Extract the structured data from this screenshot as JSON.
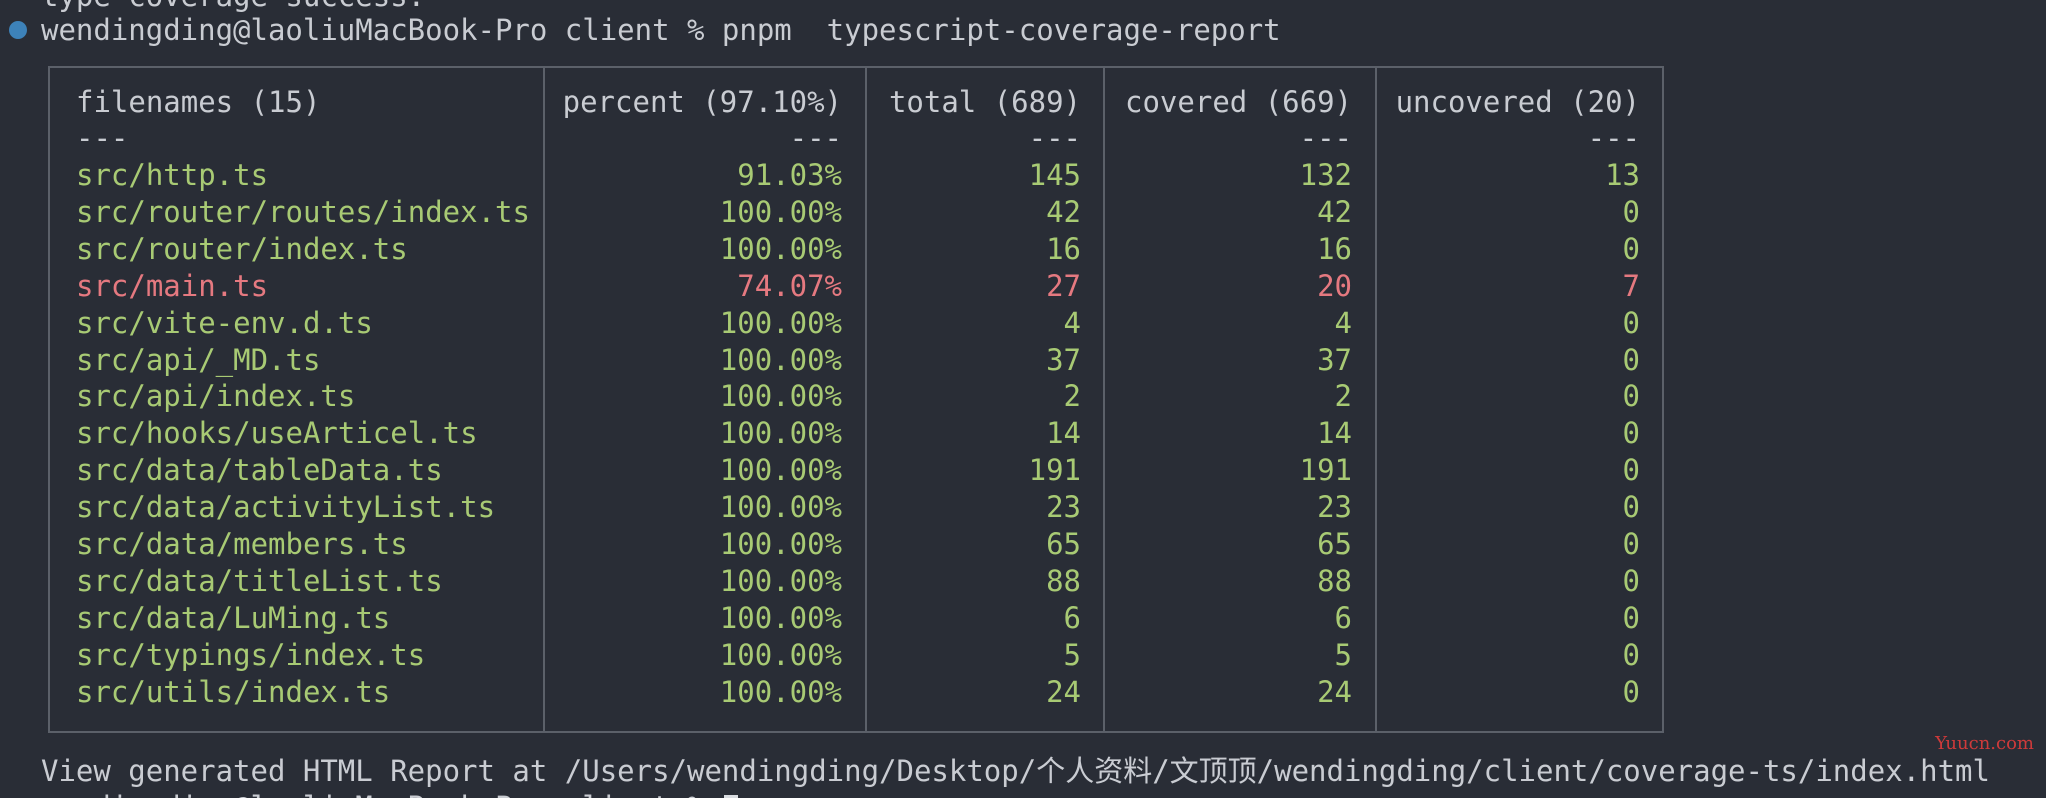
{
  "terminal": {
    "previous_line": "type-coverage success.",
    "prompt": "wendingding@laoliuMacBook-Pro client % pnpm  typescript-coverage-report",
    "report_line": "View generated HTML Report at /Users/wendingding/Desktop/个人资料/文顶顶/wendingding/client/coverage-ts/index.html",
    "next_prompt": "wendingding@laoliuMacBook-Pro client % "
  },
  "table": {
    "headers": {
      "filenames": "filenames (15)",
      "percent": "percent (97.10%)",
      "total": "total (689)",
      "covered": "covered (669)",
      "uncovered": "uncovered (20)"
    },
    "separator": "---",
    "rows": [
      {
        "file": "src/http.ts",
        "percent": "91.03%",
        "total": "145",
        "covered": "132",
        "uncovered": "13",
        "status": "ok"
      },
      {
        "file": "src/router/routes/index.ts",
        "percent": "100.00%",
        "total": "42",
        "covered": "42",
        "uncovered": "0",
        "status": "ok"
      },
      {
        "file": "src/router/index.ts",
        "percent": "100.00%",
        "total": "16",
        "covered": "16",
        "uncovered": "0",
        "status": "ok"
      },
      {
        "file": "src/main.ts",
        "percent": "74.07%",
        "total": "27",
        "covered": "20",
        "uncovered": "7",
        "status": "bad"
      },
      {
        "file": "src/vite-env.d.ts",
        "percent": "100.00%",
        "total": "4",
        "covered": "4",
        "uncovered": "0",
        "status": "ok"
      },
      {
        "file": "src/api/_MD.ts",
        "percent": "100.00%",
        "total": "37",
        "covered": "37",
        "uncovered": "0",
        "status": "ok"
      },
      {
        "file": "src/api/index.ts",
        "percent": "100.00%",
        "total": "2",
        "covered": "2",
        "uncovered": "0",
        "status": "ok"
      },
      {
        "file": "src/hooks/useArticel.ts",
        "percent": "100.00%",
        "total": "14",
        "covered": "14",
        "uncovered": "0",
        "status": "ok"
      },
      {
        "file": "src/data/tableData.ts",
        "percent": "100.00%",
        "total": "191",
        "covered": "191",
        "uncovered": "0",
        "status": "ok"
      },
      {
        "file": "src/data/activityList.ts",
        "percent": "100.00%",
        "total": "23",
        "covered": "23",
        "uncovered": "0",
        "status": "ok"
      },
      {
        "file": "src/data/members.ts",
        "percent": "100.00%",
        "total": "65",
        "covered": "65",
        "uncovered": "0",
        "status": "ok"
      },
      {
        "file": "src/data/titleList.ts",
        "percent": "100.00%",
        "total": "88",
        "covered": "88",
        "uncovered": "0",
        "status": "ok"
      },
      {
        "file": "src/data/LuMing.ts",
        "percent": "100.00%",
        "total": "6",
        "covered": "6",
        "uncovered": "0",
        "status": "ok"
      },
      {
        "file": "src/typings/index.ts",
        "percent": "100.00%",
        "total": "5",
        "covered": "5",
        "uncovered": "0",
        "status": "ok"
      },
      {
        "file": "src/utils/index.ts",
        "percent": "100.00%",
        "total": "24",
        "covered": "24",
        "uncovered": "0",
        "status": "ok"
      }
    ]
  },
  "watermark": "Yuucn.com",
  "colors": {
    "background": "#292d36",
    "text": "#c9ccd2",
    "covered_ok": "#a8ca74",
    "covered_bad": "#e57980",
    "status_dot": "#3d82b9",
    "watermark": "#cf3a3a"
  }
}
